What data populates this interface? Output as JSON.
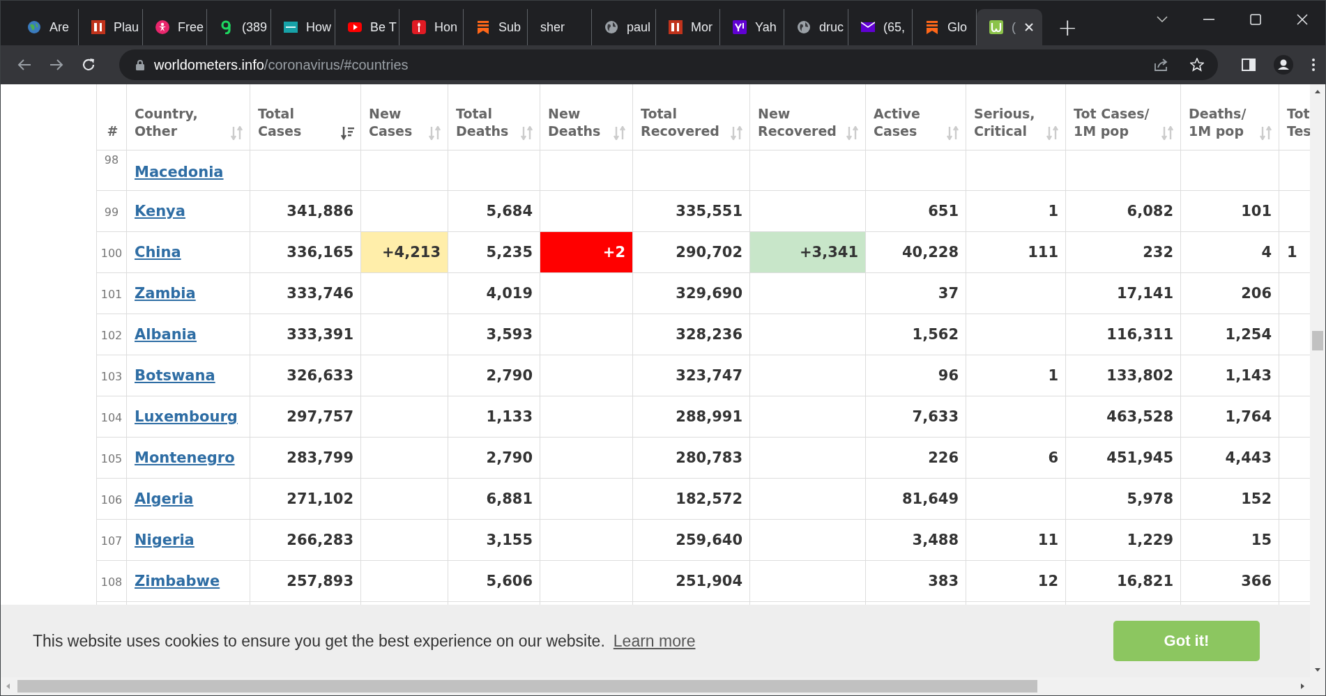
{
  "browser": {
    "tabs": [
      {
        "title": "Are",
        "selected": false
      },
      {
        "title": "Plau",
        "selected": false
      },
      {
        "title": "Free",
        "selected": false
      },
      {
        "title": "(389",
        "selected": false
      },
      {
        "title": "How",
        "selected": false
      },
      {
        "title": "Be T",
        "selected": false
      },
      {
        "title": "Hon",
        "selected": false
      },
      {
        "title": "Sub",
        "selected": false
      },
      {
        "title": "sher",
        "selected": false
      },
      {
        "title": "paul",
        "selected": false
      },
      {
        "title": "Mor",
        "selected": false
      },
      {
        "title": "Yah",
        "selected": false
      },
      {
        "title": "druc",
        "selected": false
      },
      {
        "title": "(65,",
        "selected": false
      },
      {
        "title": "Glo",
        "selected": false
      },
      {
        "title": "(",
        "selected": true
      }
    ],
    "new_tab": "+",
    "url_host": "worldometers.info",
    "url_path": "/coronavirus/#countries"
  },
  "table": {
    "columns": [
      {
        "label": "#",
        "kind": "rank"
      },
      {
        "label": "Country, Other",
        "kind": "country",
        "sorted": false
      },
      {
        "label": "Total Cases",
        "kind": "number",
        "sorted": true
      },
      {
        "label": "New Cases",
        "kind": "new_cases",
        "sorted": false
      },
      {
        "label": "Total Deaths",
        "kind": "number",
        "sorted": false
      },
      {
        "label": "New Deaths",
        "kind": "new_deaths",
        "sorted": false
      },
      {
        "label": "Total Recovered",
        "kind": "number",
        "sorted": false
      },
      {
        "label": "New Recovered",
        "kind": "new_recovered",
        "sorted": false
      },
      {
        "label": "Active Cases",
        "kind": "number",
        "sorted": false
      },
      {
        "label": "Serious, Critical",
        "kind": "number",
        "sorted": false
      },
      {
        "label": "Tot Cases/ 1M pop",
        "kind": "number",
        "sorted": false
      },
      {
        "label": "Deaths/ 1M pop",
        "kind": "number",
        "sorted": false
      },
      {
        "label": "Tot Tes",
        "kind": "cut"
      }
    ],
    "rows": [
      {
        "cells": [
          "98",
          "Macedonia",
          null,
          null,
          null,
          null,
          null,
          null,
          null,
          null,
          null,
          null,
          null
        ],
        "partial": true
      },
      {
        "cells": [
          "99",
          "Kenya",
          "341,886",
          null,
          "5,684",
          null,
          "335,551",
          null,
          "651",
          "1",
          "6,082",
          "101",
          null
        ]
      },
      {
        "cells": [
          "100",
          "China",
          "336,165",
          "+4,213",
          "5,235",
          "+2",
          "290,702",
          "+3,341",
          "40,228",
          "111",
          "232",
          "4",
          "1"
        ]
      },
      {
        "cells": [
          "101",
          "Zambia",
          "333,746",
          null,
          "4,019",
          null,
          "329,690",
          null,
          "37",
          null,
          "17,141",
          "206",
          null
        ]
      },
      {
        "cells": [
          "102",
          "Albania",
          "333,391",
          null,
          "3,593",
          null,
          "328,236",
          null,
          "1,562",
          null,
          "116,311",
          "1,254",
          null
        ]
      },
      {
        "cells": [
          "103",
          "Botswana",
          "326,633",
          null,
          "2,790",
          null,
          "323,747",
          null,
          "96",
          "1",
          "133,802",
          "1,143",
          null
        ]
      },
      {
        "cells": [
          "104",
          "Luxembourg",
          "297,757",
          null,
          "1,133",
          null,
          "288,991",
          null,
          "7,633",
          null,
          "463,528",
          "1,764",
          null
        ]
      },
      {
        "cells": [
          "105",
          "Montenegro",
          "283,799",
          null,
          "2,790",
          null,
          "280,783",
          null,
          "226",
          "6",
          "451,945",
          "4,443",
          null
        ]
      },
      {
        "cells": [
          "106",
          "Algeria",
          "271,102",
          null,
          "6,881",
          null,
          "182,572",
          null,
          "81,649",
          null,
          "5,978",
          "152",
          null
        ]
      },
      {
        "cells": [
          "107",
          "Nigeria",
          "266,283",
          null,
          "3,155",
          null,
          "259,640",
          null,
          "3,488",
          "11",
          "1,229",
          "15",
          null
        ]
      },
      {
        "cells": [
          "108",
          "Zimbabwe",
          "257,893",
          null,
          "5,606",
          null,
          "251,904",
          null,
          "383",
          "12",
          "16,821",
          "366",
          null
        ]
      }
    ]
  },
  "cookie_banner": {
    "message": "This website uses cookies to ensure you get the best experience on our website.",
    "link": "Learn more",
    "button": "Got it!"
  }
}
